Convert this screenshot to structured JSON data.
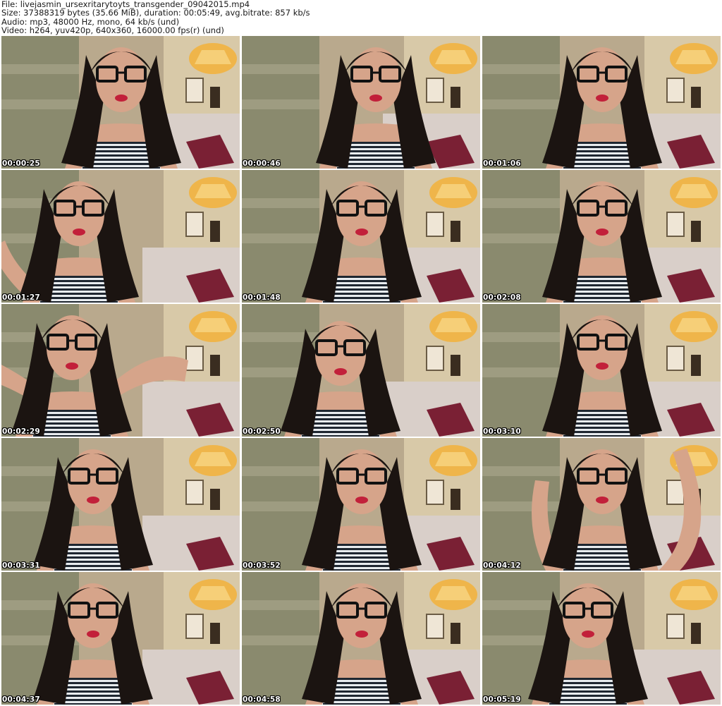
{
  "header": {
    "file_line": "File: livejasmin_ursexritarytoyts_transgender_09042015.mp4",
    "size_line": "Size: 37388319 bytes (35.66 MiB), duration: 00:05:49, avg.bitrate: 857 kb/s",
    "audio_line": "Audio: mp3, 48000 Hz, mono, 64 kb/s (und)",
    "video_line": "Video: h264, yuv420p, 640x360, 16000.00 fps(r) (und)"
  },
  "thumbnails": [
    {
      "timestamp": "00:00:25"
    },
    {
      "timestamp": "00:00:46"
    },
    {
      "timestamp": "00:01:06"
    },
    {
      "timestamp": "00:01:27"
    },
    {
      "timestamp": "00:01:48"
    },
    {
      "timestamp": "00:02:08"
    },
    {
      "timestamp": "00:02:29"
    },
    {
      "timestamp": "00:02:50"
    },
    {
      "timestamp": "00:03:10"
    },
    {
      "timestamp": "00:03:31"
    },
    {
      "timestamp": "00:03:52"
    },
    {
      "timestamp": "00:04:12"
    },
    {
      "timestamp": "00:04:37"
    },
    {
      "timestamp": "00:04:58"
    },
    {
      "timestamp": "00:05:19"
    }
  ],
  "colors": {
    "wall": "#b9a98d",
    "curtain": "#8a8a6e",
    "lamp_glow": "#f3b23a",
    "bed": "#d9cfc9",
    "pillow": "#7a2034",
    "hair": "#1b1411",
    "skin": "#d6a48a",
    "stripe_dark": "#1e2630",
    "stripe_light": "#e8ecef",
    "glasses": "#111111",
    "lips": "#c2203a"
  }
}
